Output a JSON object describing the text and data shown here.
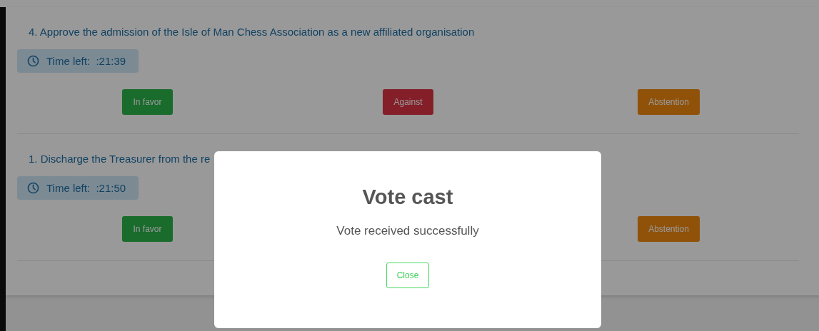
{
  "questions": [
    {
      "title": "4. Approve the admission of the Isle of Man Chess Association as a new affiliated organisation",
      "timer": "Time left:  :21:39",
      "buttons": [
        {
          "label": "In favor",
          "kind": "favor"
        },
        {
          "label": "Against",
          "kind": "against"
        },
        {
          "label": "Abstention",
          "kind": "abstain"
        }
      ]
    },
    {
      "title": "1. Discharge the Treasurer from the re",
      "timer": "Time left:  :21:50",
      "buttons": [
        {
          "label": "In favor",
          "kind": "favor"
        },
        {
          "label": "Abstention",
          "kind": "abstain"
        }
      ]
    }
  ],
  "modal": {
    "title": "Vote cast",
    "message": "Vote received successfully",
    "button": "Close"
  }
}
